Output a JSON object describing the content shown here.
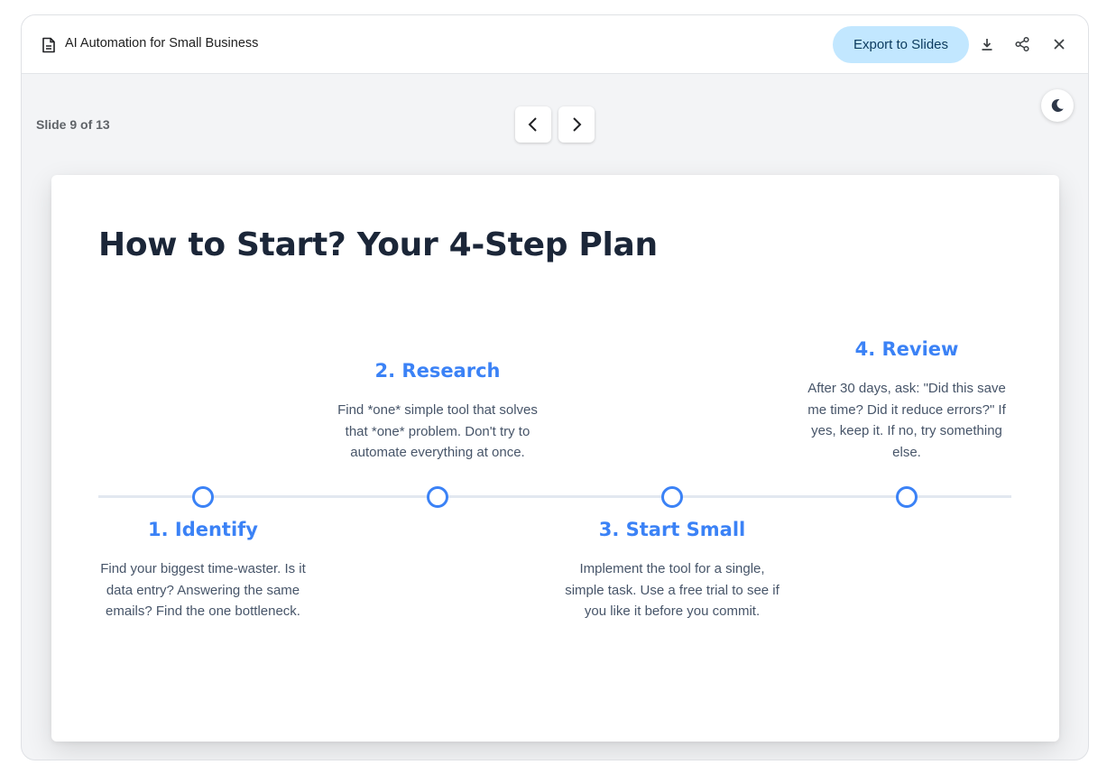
{
  "header": {
    "doc_title": "AI Automation for Small Business",
    "export_label": "Export to Slides"
  },
  "icons": {
    "doc": "document-icon",
    "download": "download-icon",
    "share": "share-icon",
    "close": "close-icon",
    "prev": "chevron-left-icon",
    "next": "chevron-right-icon",
    "theme": "moon-icon"
  },
  "viewer": {
    "slide_counter": "Slide 9 of 13"
  },
  "slide": {
    "title": "How to Start? Your 4-Step Plan",
    "steps": [
      {
        "title": "1. Identify",
        "description": "Find your biggest time-waster. Is it data entry? Answering the same emails? Find the one bottleneck."
      },
      {
        "title": "2. Research",
        "description": "Find *one* simple tool that solves that *one* problem. Don't try to automate everything at once."
      },
      {
        "title": "3. Start Small",
        "description": "Implement the tool for a single, simple task. Use a free trial to see if you like it before you commit."
      },
      {
        "title": "4. Review",
        "description": "After 30 days, ask: \"Did this save me time? Did it reduce errors?\" If yes, keep it. If no, try something else."
      }
    ]
  },
  "colors": {
    "accent": "#3b82f6",
    "title": "#1b2638",
    "body_text": "#475569",
    "export_bg": "#c2e7ff",
    "canvas_bg": "#f3f4f6"
  }
}
